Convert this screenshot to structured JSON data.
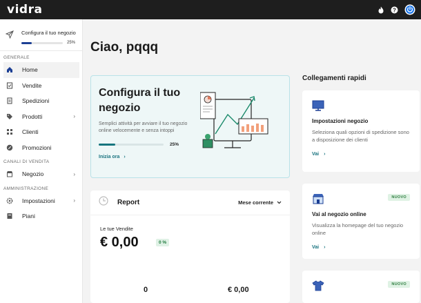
{
  "brand": "vidra",
  "topbar": {
    "icons": [
      "flame-icon",
      "help-icon",
      "power-icon"
    ]
  },
  "sidebar": {
    "setup": {
      "label": "Configura il tuo negozio",
      "progress": 0.25,
      "progress_text": "25%"
    },
    "sections": {
      "generale": "GENERALE",
      "canali": "CANALI DI VENDITA",
      "amministrazione": "AMMINISTRAZIONE"
    },
    "items": {
      "home": "Home",
      "vendite": "Vendite",
      "spedizioni": "Spedizioni",
      "prodotti": "Prodotti",
      "clienti": "Clienti",
      "promozioni": "Promozioni",
      "negozio": "Negozio",
      "impostazioni": "Impostazioni",
      "piani": "Piani"
    }
  },
  "main": {
    "greeting": "Ciao, pqqq",
    "configure": {
      "title": "Configura il tuo negozio",
      "description": "Semplici attività per avviare il tuo negozio online velocemente e senza intoppi",
      "progress": 0.25,
      "progress_text": "25%",
      "link": "Inizia ora"
    },
    "report": {
      "title": "Report",
      "period": "Mese corrente",
      "sales_label": "Le tue Vendite",
      "sales_value": "€ 0,00",
      "sales_change": "0 %",
      "orders_count": "0",
      "orders_total": "€ 0,00"
    },
    "quick_links": {
      "title": "Collegamenti rapidi",
      "cards": [
        {
          "title": "Impostazioni negozio",
          "description": "Seleziona quali opzioni di spedizione sono a disposizione dei clienti",
          "link": "Vai",
          "badge": ""
        },
        {
          "title": "Vai al negozio online",
          "description": "Visualizza la homepage del tuo negozio online",
          "link": "Vai",
          "badge": "NUOVO"
        },
        {
          "title": "",
          "description": "",
          "link": "",
          "badge": "NUOVO"
        }
      ]
    }
  },
  "colors": {
    "topbar": "#1e1e1e",
    "accent": "#1a7480",
    "progress_sidebar": "#1c3f94",
    "badge_green": "#2e7d3f"
  }
}
